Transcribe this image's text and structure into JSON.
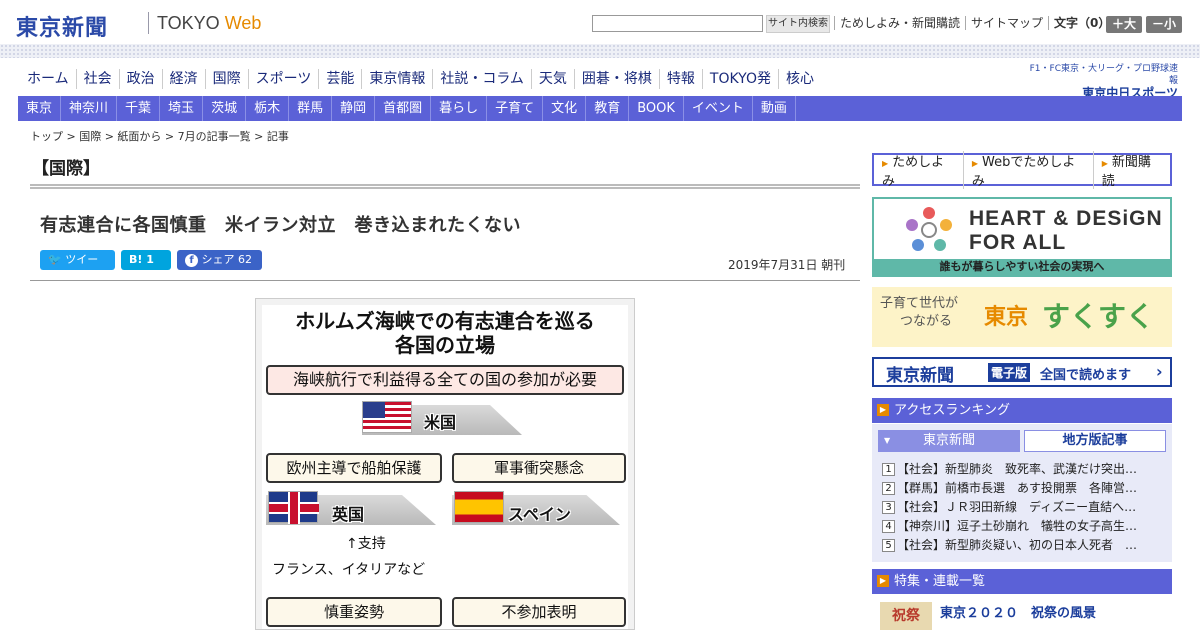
{
  "header": {
    "logo": "東京新聞",
    "logo_sub_a": "TOKYO ",
    "logo_sub_b": "Web",
    "search_placeholder": "",
    "search_button": "サイト内検索",
    "links": [
      "ためしよみ・新聞購読",
      "サイトマップ"
    ],
    "font_size_label": "文字（0）",
    "font_larger": "＋大",
    "font_smaller": "－小"
  },
  "main_nav": [
    "ホーム",
    "社会",
    "政治",
    "経済",
    "国際",
    "スポーツ",
    "芸能",
    "東京情報",
    "社説・コラム",
    "天気",
    "囲碁・将棋",
    "特報",
    "TOKYO発",
    "核心"
  ],
  "chunichi_ad": {
    "line1": "F1・FC東京・大リーグ・プロ野球速報",
    "line2": "東京中日スポーツ"
  },
  "regional_nav": [
    "東京",
    "神奈川",
    "千葉",
    "埼玉",
    "茨城",
    "栃木",
    "群馬",
    "静岡",
    "首都圏",
    "暮らし",
    "子育て",
    "文化",
    "教育",
    "BOOK",
    "イベント",
    "動画"
  ],
  "breadcrumb": "トップ > 国際 > 紙面から > 7月の記事一覧 > 記事",
  "section_title": "【国際】",
  "article": {
    "headline": "有志連合に各国慎重　米イラン対立　巻き込まれたくない",
    "share_tweet": "ツイート",
    "share_hatena": "B!  1",
    "share_facebook": "シェア 62",
    "date": "2019年7月31日 朝刊"
  },
  "infographic": {
    "title_line1": "ホルムズ海峡での有志連合を巡る",
    "title_line2": "各国の立場",
    "us_position": "海峡航行で利益得る全ての国の参加が必要",
    "us_label": "米国",
    "uk_position": "欧州主導で船舶保護",
    "uk_label": "英国",
    "es_position": "軍事衝突懸念",
    "es_label": "スペイン",
    "support_label": "↑支持",
    "support_countries": "フランス、イタリアなど",
    "cautious_label": "慎重姿勢",
    "nonparticipation_label": "不参加表明"
  },
  "sidebar": {
    "links": [
      "ためしよみ",
      "Webでためしよみ",
      "新聞購読"
    ],
    "heart_design_line1": "HEART & DESiGN",
    "heart_design_line2": "FOR ALL",
    "heart_design_caption": "誰もが暮らしやすい社会の実現へ",
    "sukusuku_a1": "子育て世代が",
    "sukusuku_a2": "つながる",
    "sukusuku_b": "東京",
    "sukusuku_c": "すくすく",
    "eshinbun_logo": "東京新聞",
    "eshinbun_tag": "電子版",
    "eshinbun_text": "全国で読めます",
    "ranking_title": "アクセスランキング",
    "ranking_tab1": "東京新聞",
    "ranking_tab2": "地方版記事",
    "ranking": [
      "【社会】新型肺炎　致死率、武漢だけ突出…",
      "【群馬】前橋市長選　あす投開票　各陣営…",
      "【社会】ＪＲ羽田新線　ディズニー直結へ…",
      "【神奈川】逗子土砂崩れ　犠牲の女子高生…",
      "【社会】新型肺炎疑い、初の日本人死者　…"
    ],
    "features_title": "特集・連載一覧",
    "feature_thumb": "祝祭",
    "feature_item": "東京２０２０　祝祭の風景"
  }
}
